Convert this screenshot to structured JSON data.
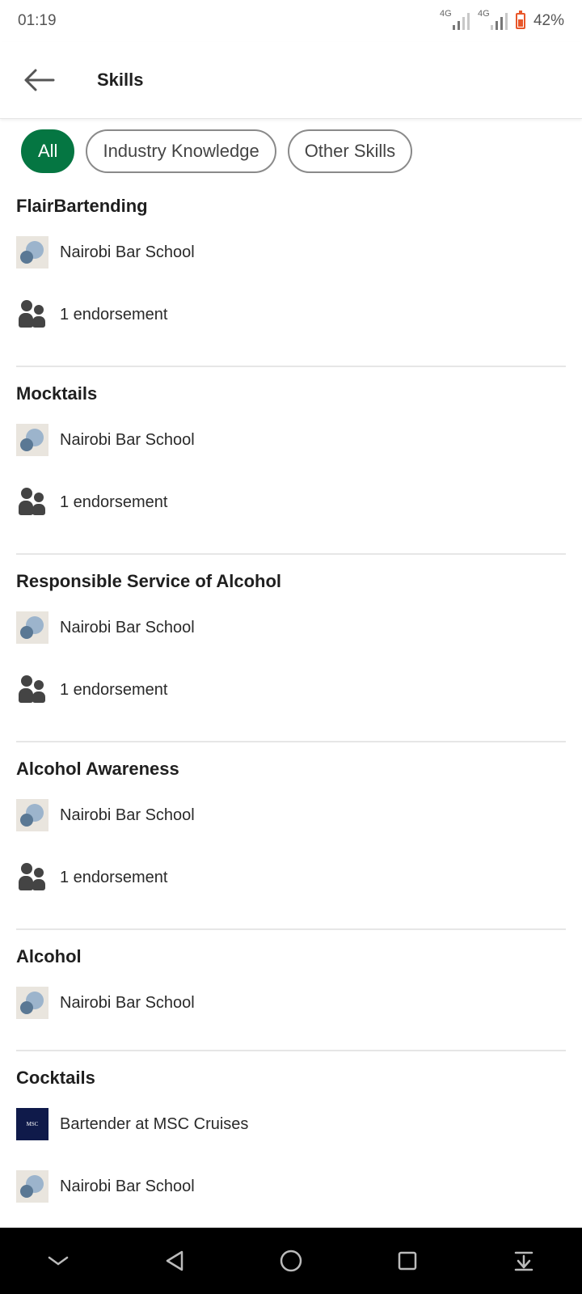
{
  "status": {
    "time": "01:19",
    "net1": "4G",
    "net2": "4G",
    "battery": "42%"
  },
  "appbar": {
    "title": "Skills"
  },
  "filters": [
    {
      "label": "All",
      "active": true
    },
    {
      "label": "Industry Knowledge",
      "active": false
    },
    {
      "label": "Other Skills",
      "active": false
    }
  ],
  "skills": [
    {
      "title": "FlairBartending",
      "rows": [
        {
          "text": "Nairobi Bar School",
          "icon": "school-logo"
        },
        {
          "text": "1 endorsement",
          "icon": "people-icon"
        }
      ]
    },
    {
      "title": "Mocktails",
      "rows": [
        {
          "text": "Nairobi Bar School",
          "icon": "school-logo"
        },
        {
          "text": "1 endorsement",
          "icon": "people-icon"
        }
      ]
    },
    {
      "title": "Responsible Service of Alcohol",
      "rows": [
        {
          "text": "Nairobi Bar School",
          "icon": "school-logo"
        },
        {
          "text": "1 endorsement",
          "icon": "people-icon"
        }
      ]
    },
    {
      "title": "Alcohol Awareness",
      "rows": [
        {
          "text": "Nairobi Bar School",
          "icon": "school-logo"
        },
        {
          "text": "1 endorsement",
          "icon": "people-icon"
        }
      ]
    },
    {
      "title": "Alcohol",
      "rows": [
        {
          "text": "Nairobi Bar School",
          "icon": "school-logo"
        }
      ]
    },
    {
      "title": "Cocktails",
      "rows": [
        {
          "text": "Bartender at MSC Cruises",
          "icon": "msc-logo"
        },
        {
          "text": "Nairobi Bar School",
          "icon": "school-logo"
        }
      ]
    }
  ],
  "msc_logo_text": "MSC",
  "colors": {
    "accent": "#057642",
    "divider": "#e6e6e6"
  }
}
